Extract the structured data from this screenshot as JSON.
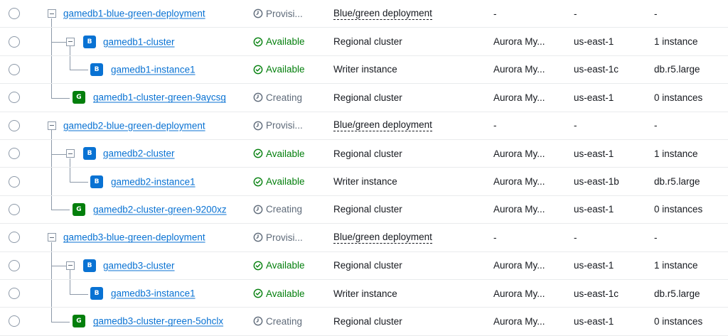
{
  "rows": [
    {
      "level": 0,
      "identifier": "gamedb1-blue-green-deployment",
      "badge": "",
      "status": "Provisi...",
      "status_kind": "wait",
      "role": "Blue/green deployment",
      "engine": "-",
      "region": "-",
      "size": "-"
    },
    {
      "level": 1,
      "identifier": "gamedb1-cluster",
      "badge": "B",
      "status": "Available",
      "status_kind": "ok",
      "role": "Regional cluster",
      "engine": "Aurora My...",
      "region": "us-east-1",
      "size": "1 instance"
    },
    {
      "level": 2,
      "identifier": "gamedb1-instance1",
      "badge": "B",
      "status": "Available",
      "status_kind": "ok",
      "role": "Writer instance",
      "engine": "Aurora My...",
      "region": "us-east-1c",
      "size": "db.r5.large"
    },
    {
      "level": 3,
      "identifier": "gamedb1-cluster-green-9aycsg",
      "badge": "G",
      "status": "Creating",
      "status_kind": "wait",
      "role": "Regional cluster",
      "engine": "Aurora My...",
      "region": "us-east-1",
      "size": "0 instances"
    },
    {
      "level": 0,
      "identifier": "gamedb2-blue-green-deployment",
      "badge": "",
      "status": "Provisi...",
      "status_kind": "wait",
      "role": "Blue/green deployment",
      "engine": "-",
      "region": "-",
      "size": "-"
    },
    {
      "level": 1,
      "identifier": "gamedb2-cluster",
      "badge": "B",
      "status": "Available",
      "status_kind": "ok",
      "role": "Regional cluster",
      "engine": "Aurora My...",
      "region": "us-east-1",
      "size": "1 instance"
    },
    {
      "level": 2,
      "identifier": "gamedb2-instance1",
      "badge": "B",
      "status": "Available",
      "status_kind": "ok",
      "role": "Writer instance",
      "engine": "Aurora My...",
      "region": "us-east-1b",
      "size": "db.r5.large"
    },
    {
      "level": 3,
      "identifier": "gamedb2-cluster-green-9200xz",
      "badge": "G",
      "status": "Creating",
      "status_kind": "wait",
      "role": "Regional cluster",
      "engine": "Aurora My...",
      "region": "us-east-1",
      "size": "0 instances"
    },
    {
      "level": 0,
      "identifier": "gamedb3-blue-green-deployment",
      "badge": "",
      "status": "Provisi...",
      "status_kind": "wait",
      "role": "Blue/green deployment",
      "engine": "-",
      "region": "-",
      "size": "-"
    },
    {
      "level": 1,
      "identifier": "gamedb3-cluster",
      "badge": "B",
      "status": "Available",
      "status_kind": "ok",
      "role": "Regional cluster",
      "engine": "Aurora My...",
      "region": "us-east-1",
      "size": "1 instance"
    },
    {
      "level": 2,
      "identifier": "gamedb3-instance1",
      "badge": "B",
      "status": "Available",
      "status_kind": "ok",
      "role": "Writer instance",
      "engine": "Aurora My...",
      "region": "us-east-1c",
      "size": "db.r5.large"
    },
    {
      "level": 3,
      "identifier": "gamedb3-cluster-green-5ohclx",
      "badge": "G",
      "status": "Creating",
      "status_kind": "wait",
      "role": "Regional cluster",
      "engine": "Aurora My...",
      "region": "us-east-1",
      "size": "0 instances"
    }
  ],
  "colors": {
    "link": "#0972d3",
    "available": "#037f0c",
    "pending": "#5f6b7a",
    "badge_blue": "#0972d3",
    "badge_green": "#037f0c"
  },
  "icons": {
    "available": "check-circle-icon",
    "pending": "clock-icon",
    "expand": "collapse-square-icon"
  }
}
